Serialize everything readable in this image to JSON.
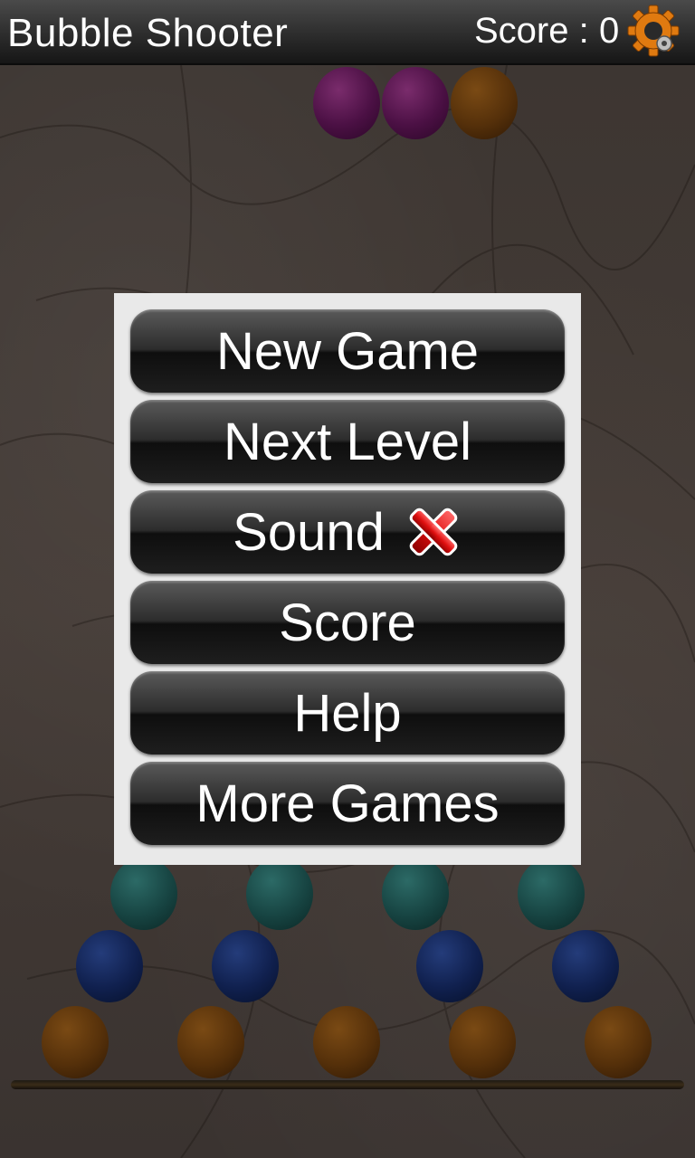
{
  "header": {
    "title": "Bubble Shooter",
    "score_label": "Score :",
    "score_value": "0",
    "settings_icon": "gear-icon"
  },
  "menu": {
    "items": [
      {
        "label": "New Game"
      },
      {
        "label": "Next Level"
      },
      {
        "label": "Sound",
        "status_icon": "red-x-icon",
        "sound_enabled": false
      },
      {
        "label": "Score"
      },
      {
        "label": "Help"
      },
      {
        "label": "More Games"
      }
    ]
  },
  "board": {
    "rows": [
      [
        "purple",
        "purple",
        "orange"
      ],
      [
        "teal",
        "teal",
        "teal",
        "teal"
      ],
      [
        "blue",
        "blue",
        "blue",
        "blue"
      ],
      [
        "orange",
        "orange",
        "orange",
        "orange",
        "orange"
      ]
    ]
  },
  "colors": {
    "purple": "#4b1044",
    "orange": "#55300a",
    "teal": "#174442",
    "blue": "#10204e",
    "panel": "#e9e9e9",
    "button": "#2c2c2c",
    "text": "#ffffff"
  }
}
